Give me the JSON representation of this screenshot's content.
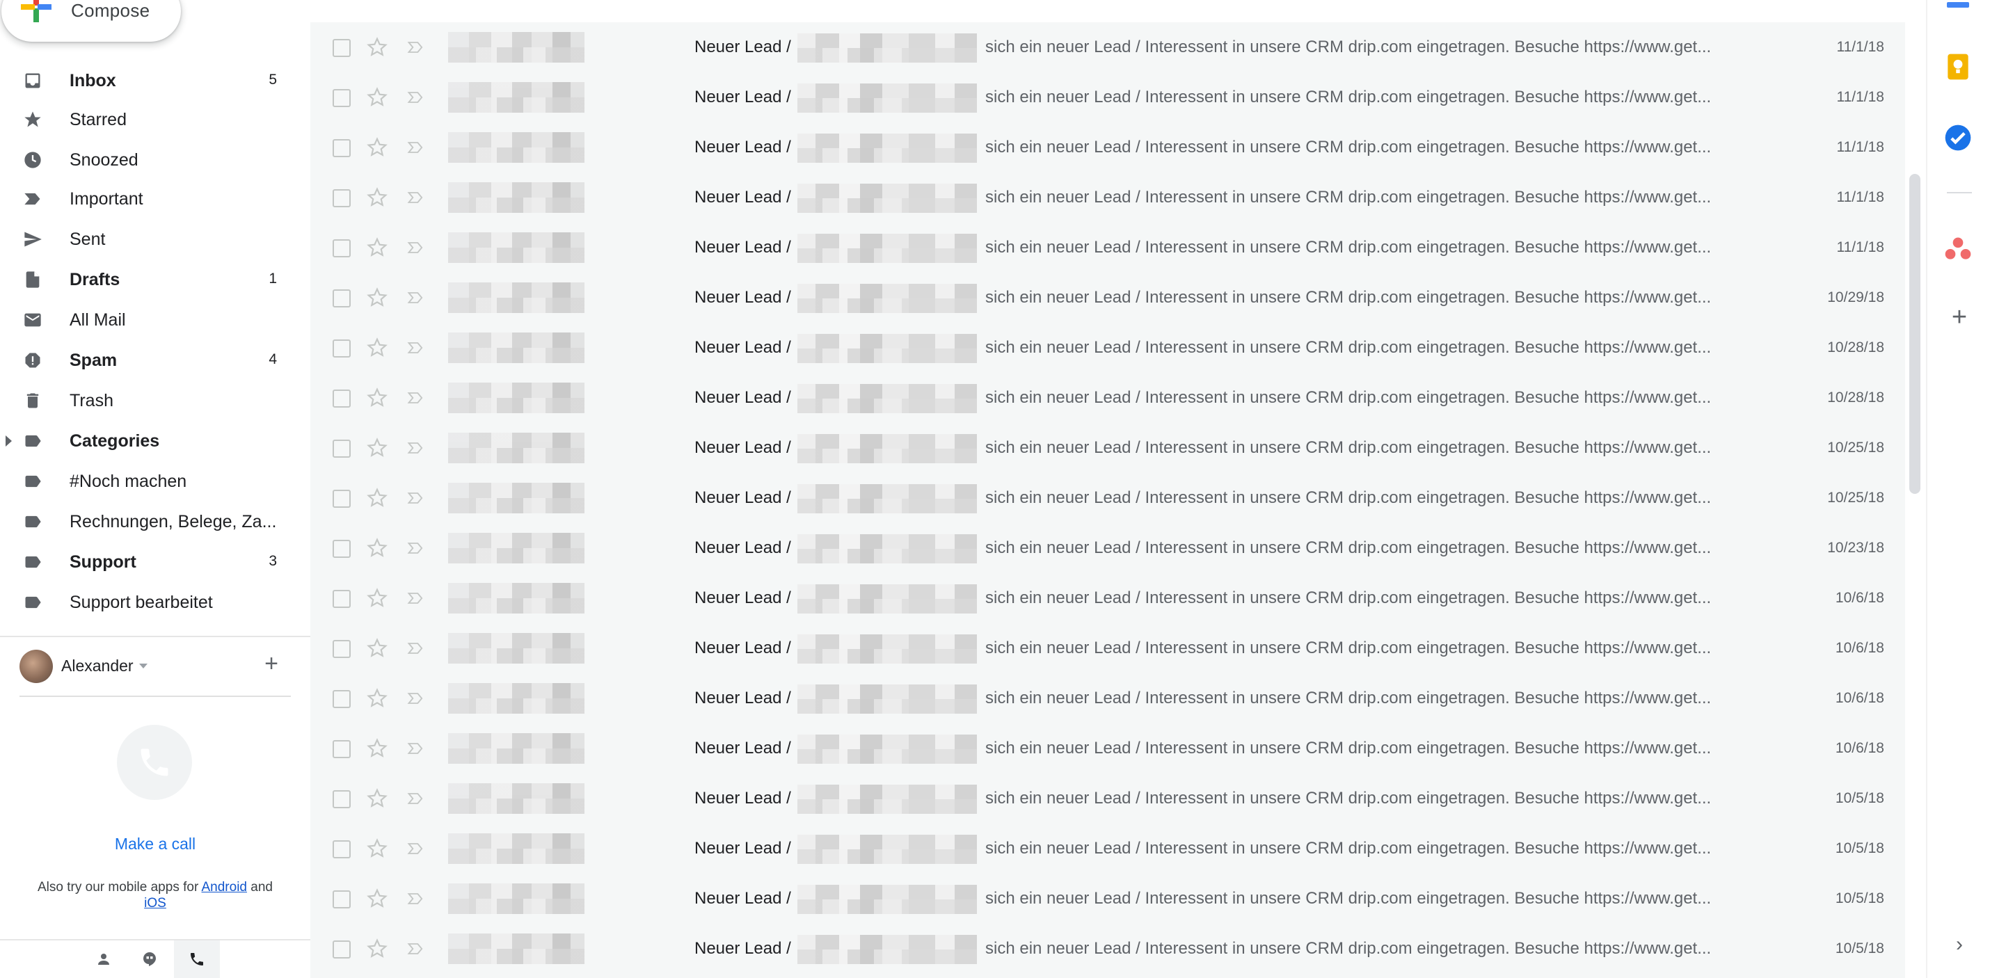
{
  "compose": {
    "label": "Compose"
  },
  "sidebar": {
    "items": [
      {
        "label": "Inbox",
        "count": "5",
        "bold": true,
        "icon": "inbox-icon"
      },
      {
        "label": "Starred",
        "count": "",
        "bold": false,
        "icon": "star-icon"
      },
      {
        "label": "Snoozed",
        "count": "",
        "bold": false,
        "icon": "clock-icon"
      },
      {
        "label": "Important",
        "count": "",
        "bold": false,
        "icon": "important-icon"
      },
      {
        "label": "Sent",
        "count": "",
        "bold": false,
        "icon": "send-icon"
      },
      {
        "label": "Drafts",
        "count": "1",
        "bold": true,
        "icon": "draft-icon"
      },
      {
        "label": "All Mail",
        "count": "",
        "bold": false,
        "icon": "mail-icon"
      },
      {
        "label": "Spam",
        "count": "4",
        "bold": true,
        "icon": "spam-icon"
      },
      {
        "label": "Trash",
        "count": "",
        "bold": false,
        "icon": "trash-icon"
      },
      {
        "label": "Categories",
        "count": "",
        "bold": true,
        "icon": "label-icon"
      },
      {
        "label": "#Noch machen",
        "count": "",
        "bold": false,
        "icon": "label-icon"
      },
      {
        "label": "Rechnungen, Belege, Za...",
        "count": "",
        "bold": false,
        "icon": "label-icon"
      },
      {
        "label": "Support",
        "count": "3",
        "bold": true,
        "icon": "label-icon"
      },
      {
        "label": "Support bearbeitet",
        "count": "",
        "bold": false,
        "icon": "label-icon"
      }
    ]
  },
  "account": {
    "name": "Alexander"
  },
  "hangouts": {
    "make_call": "Make a call",
    "note_prefix": "Also try our mobile apps for",
    "android": "Android",
    "and": "and",
    "ios": "iOS"
  },
  "emails": [
    {
      "subject": "Neuer Lead /",
      "snippet": "sich ein neuer Lead / Interessent in unsere CRM drip.com eingetragen. Besuche https://www.get...",
      "date": "11/1/18"
    },
    {
      "subject": "Neuer Lead /",
      "snippet": "sich ein neuer Lead / Interessent in unsere CRM drip.com eingetragen. Besuche https://www.get...",
      "date": "11/1/18"
    },
    {
      "subject": "Neuer Lead /",
      "snippet": "sich ein neuer Lead / Interessent in unsere CRM drip.com eingetragen. Besuche https://www.get...",
      "date": "11/1/18"
    },
    {
      "subject": "Neuer Lead /",
      "snippet": "sich ein neuer Lead / Interessent in unsere CRM drip.com eingetragen. Besuche https://www.get...",
      "date": "11/1/18"
    },
    {
      "subject": "Neuer Lead /",
      "snippet": "sich ein neuer Lead / Interessent in unsere CRM drip.com eingetragen. Besuche https://www.get...",
      "date": "11/1/18"
    },
    {
      "subject": "Neuer Lead /",
      "snippet": "sich ein neuer Lead / Interessent in unsere CRM drip.com eingetragen. Besuche https://www.get...",
      "date": "10/29/18"
    },
    {
      "subject": "Neuer Lead /",
      "snippet": "sich ein neuer Lead / Interessent in unsere CRM drip.com eingetragen. Besuche https://www.get...",
      "date": "10/28/18"
    },
    {
      "subject": "Neuer Lead /",
      "snippet": "sich ein neuer Lead / Interessent in unsere CRM drip.com eingetragen. Besuche https://www.get...",
      "date": "10/28/18"
    },
    {
      "subject": "Neuer Lead /",
      "snippet": "sich ein neuer Lead / Interessent in unsere CRM drip.com eingetragen. Besuche https://www.get...",
      "date": "10/25/18"
    },
    {
      "subject": "Neuer Lead /",
      "snippet": "sich ein neuer Lead / Interessent in unsere CRM drip.com eingetragen. Besuche https://www.get...",
      "date": "10/25/18"
    },
    {
      "subject": "Neuer Lead /",
      "snippet": "sich ein neuer Lead / Interessent in unsere CRM drip.com eingetragen. Besuche https://www.get...",
      "date": "10/23/18"
    },
    {
      "subject": "Neuer Lead /",
      "snippet": "sich ein neuer Lead / Interessent in unsere CRM drip.com eingetragen. Besuche https://www.get...",
      "date": "10/6/18"
    },
    {
      "subject": "Neuer Lead /",
      "snippet": "sich ein neuer Lead / Interessent in unsere CRM drip.com eingetragen. Besuche https://www.get...",
      "date": "10/6/18"
    },
    {
      "subject": "Neuer Lead /",
      "snippet": "sich ein neuer Lead / Interessent in unsere CRM drip.com eingetragen. Besuche https://www.get...",
      "date": "10/6/18"
    },
    {
      "subject": "Neuer Lead /",
      "snippet": "sich ein neuer Lead / Interessent in unsere CRM drip.com eingetragen. Besuche https://www.get...",
      "date": "10/6/18"
    },
    {
      "subject": "Neuer Lead /",
      "snippet": "sich ein neuer Lead / Interessent in unsere CRM drip.com eingetragen. Besuche https://www.get...",
      "date": "10/5/18"
    },
    {
      "subject": "Neuer Lead /",
      "snippet": "sich ein neuer Lead / Interessent in unsere CRM drip.com eingetragen. Besuche https://www.get...",
      "date": "10/5/18"
    },
    {
      "subject": "Neuer Lead /",
      "snippet": "sich ein neuer Lead / Interessent in unsere CRM drip.com eingetragen. Besuche https://www.get...",
      "date": "10/5/18"
    },
    {
      "subject": "Neuer Lead /",
      "snippet": "sich ein neuer Lead / Interessent in unsere CRM drip.com eingetragen. Besuche https://www.get...",
      "date": "10/5/18"
    }
  ],
  "right_rail": {
    "items": [
      {
        "icon": "keep-icon",
        "color": "#f4b400"
      },
      {
        "icon": "tasks-icon",
        "color": "#1a73e8"
      },
      {
        "icon": "asana-icon",
        "color": "#f06a6a"
      }
    ]
  },
  "colors": {
    "accent": "#1a73e8",
    "row_background": "#f5f7f7",
    "link": "#1155cc"
  }
}
